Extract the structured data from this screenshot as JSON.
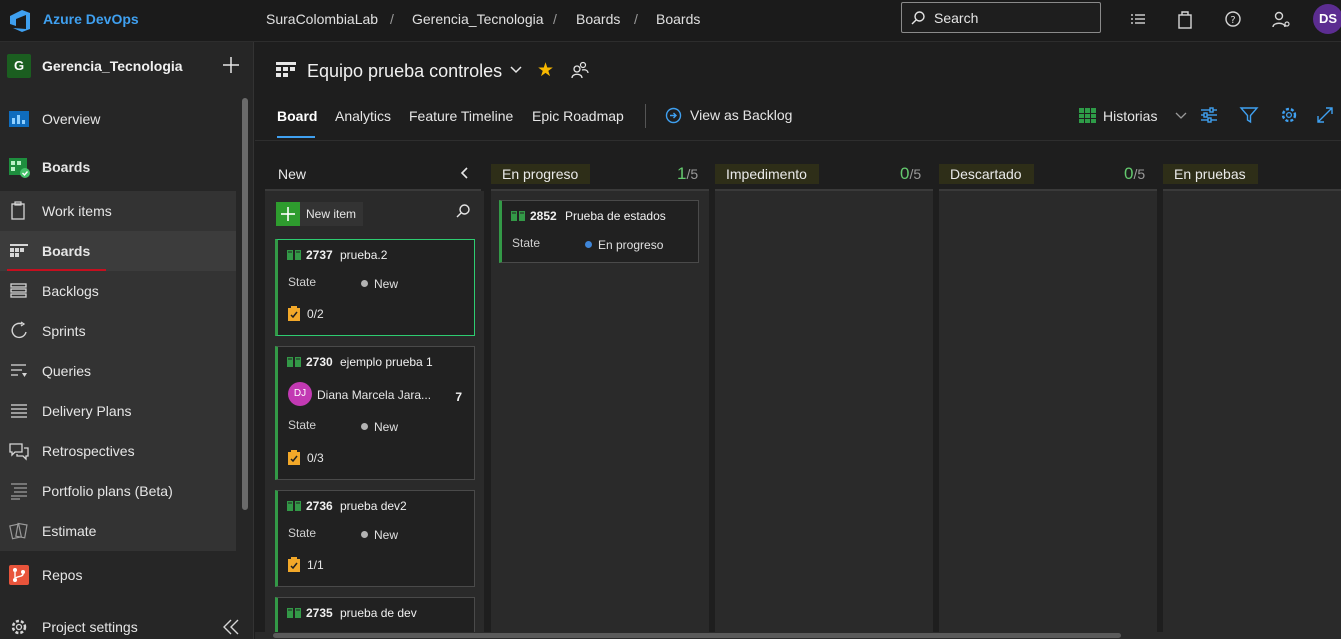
{
  "topbar": {
    "brand": "Azure DevOps",
    "breadcrumbs": [
      "SuraColombiaLab",
      "Gerencia_Tecnologia",
      "Boards",
      "Boards"
    ],
    "search_placeholder": "Search",
    "avatar_initials": "DS"
  },
  "sidebar": {
    "project_initial": "G",
    "project_name": "Gerencia_Tecnologia",
    "items": [
      {
        "label": "Overview"
      },
      {
        "label": "Boards"
      },
      {
        "label": "Work items"
      },
      {
        "label": "Boards"
      },
      {
        "label": "Backlogs"
      },
      {
        "label": "Sprints"
      },
      {
        "label": "Queries"
      },
      {
        "label": "Delivery Plans"
      },
      {
        "label": "Retrospectives"
      },
      {
        "label": "Portfolio plans (Beta)"
      },
      {
        "label": "Estimate"
      },
      {
        "label": "Repos"
      },
      {
        "label": "Project settings"
      }
    ]
  },
  "header": {
    "team_name": "Equipo prueba controles",
    "tabs": [
      "Board",
      "Analytics",
      "Feature Timeline",
      "Epic Roadmap"
    ],
    "view_as_backlog": "View as Backlog",
    "backlog_level": "Historias"
  },
  "columns": [
    {
      "name": "New",
      "count": "",
      "limit": ""
    },
    {
      "name": "En progreso",
      "count": "1",
      "limit": "/5"
    },
    {
      "name": "Impedimento",
      "count": "0",
      "limit": "/5"
    },
    {
      "name": "Descartado",
      "count": "0",
      "limit": "/5"
    },
    {
      "name": "En pruebas",
      "count": "",
      "limit": ""
    }
  ],
  "new_item_label": "New item",
  "cards": {
    "c2737": {
      "id": "2737",
      "title": "prueba.2",
      "state_label": "State",
      "state": "New",
      "tasks": "0/2"
    },
    "c2730": {
      "id": "2730",
      "title": "ejemplo prueba 1",
      "assignee_initials": "DJ",
      "assignee": "Diana Marcela Jara...",
      "effort": "7",
      "state_label": "State",
      "state": "New",
      "tasks": "0/3"
    },
    "c2736": {
      "id": "2736",
      "title": "prueba dev2",
      "state_label": "State",
      "state": "New",
      "tasks": "1/1"
    },
    "c2735": {
      "id": "2735",
      "title": "prueba de dev"
    },
    "c2852": {
      "id": "2852",
      "title": "Prueba de estados",
      "state_label": "State",
      "state": "En progreso"
    }
  },
  "colors": {
    "brand": "#3fa0f0",
    "story": "#339947",
    "state_new": "#b2b2b2",
    "state_in_progress": "#3f86d9",
    "star": "#f8b800",
    "assignee": "#c239b3"
  }
}
